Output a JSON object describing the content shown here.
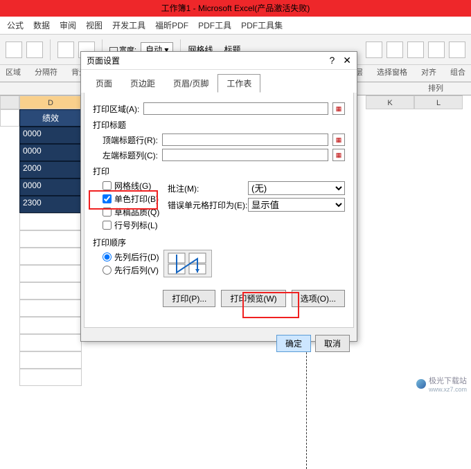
{
  "title": "工作簿1 - Microsoft Excel(产品激活失败)",
  "ribbon_tabs": [
    "公式",
    "数据",
    "审阅",
    "视图",
    "开发工具",
    "福昕PDF",
    "PDF工具",
    "PDF工具集"
  ],
  "ribbon": {
    "width_label": "宽度:",
    "width_value": "自动",
    "gridlines": "网格线",
    "headings": "标题",
    "group2a": "区域",
    "group2b": "分隔符",
    "group2c": "背景",
    "right1": "层",
    "right2": "选择窗格",
    "right3": "对齐",
    "right4": "组合",
    "arrange": "排列"
  },
  "columns": {
    "D": "D",
    "K": "K",
    "L": "L"
  },
  "data": {
    "header": "绩效",
    "rows": [
      "0000",
      "0000",
      "2000",
      "0000",
      "2300"
    ]
  },
  "dialog": {
    "title": "页面设置",
    "help": "?",
    "close": "✕",
    "tabs": [
      "页面",
      "页边距",
      "页眉/页脚",
      "工作表"
    ],
    "print_area_label": "打印区域(A):",
    "print_titles": "打印标题",
    "top_row_label": "顶端标题行(R):",
    "left_col_label": "左端标题列(C):",
    "print_label": "打印",
    "gridlines": "网格线(G)",
    "mono": "单色打印(B)",
    "draft": "草稿品质(Q)",
    "rowcol": "行号列标(L)",
    "comments_label": "批注(M):",
    "comments_value": "(无)",
    "errors_label": "错误单元格打印为(E):",
    "errors_value": "显示值",
    "order_label": "打印顺序",
    "order1": "先列后行(D)",
    "order2": "先行后列(V)",
    "print_btn": "打印(P)...",
    "preview_btn": "打印预览(W)",
    "options_btn": "选项(O)...",
    "ok": "确定",
    "cancel": "取消"
  },
  "watermark": {
    "text": "极光下载站",
    "url": "www.xz7.com"
  }
}
